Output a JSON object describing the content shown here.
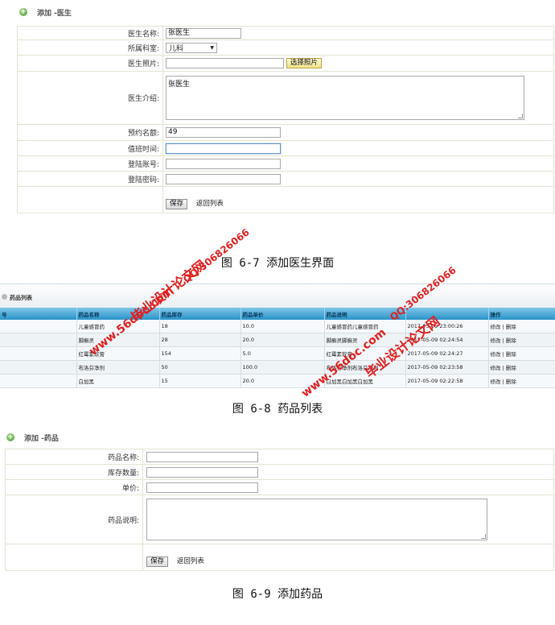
{
  "doctor_form": {
    "title": "添加 -医生",
    "labels": {
      "name": "医生名称:",
      "dept": "所属科室:",
      "photo": "医生照片:",
      "intro": "医生介绍:",
      "quota": "预约名额:",
      "duty": "值班时间:",
      "account": "登陆账号:",
      "password": "登陆密码:"
    },
    "values": {
      "name": "张医生",
      "dept": "儿科",
      "photo": "",
      "intro": "张医生",
      "quota": "49",
      "duty": "",
      "account": "",
      "password": ""
    },
    "choose_photo": "选择照片",
    "save": "保存",
    "back": "返回列表"
  },
  "caption_1": "图 6-7 添加医生界面",
  "medicine_list": {
    "title": "药品列表",
    "columns": [
      "号",
      "药品名称",
      "药品库存",
      "药品单价",
      "药品说明",
      "",
      "操作"
    ],
    "rows": [
      {
        "name": "儿童感冒药",
        "stock": "18",
        "price": "10.0",
        "desc": "儿童感冒药儿童感冒药",
        "time": "2017-05-09 23:00:26",
        "ops": "修改 | 删除"
      },
      {
        "name": "脚癣灵",
        "stock": "28",
        "price": "20.0",
        "desc": "脚癣灵脚癣灵",
        "time": "2017-05-09 02:24:54",
        "ops": "修改 | 删除"
      },
      {
        "name": "红霉素软膏",
        "stock": "154",
        "price": "5.0",
        "desc": "红霉素软膏",
        "time": "2017-05-09 02:24:27",
        "ops": "修改 | 删除"
      },
      {
        "name": "布洛芬净剂",
        "stock": "50",
        "price": "100.0",
        "desc": "布洛芬净剂布洛芬净剂",
        "time": "2017-05-09 02:23:58",
        "ops": "修改 | 删除"
      },
      {
        "name": "白加黑",
        "stock": "15",
        "price": "20.0",
        "desc": "白加黑白加黑白加黑",
        "time": "2017-05-09 02:22:58",
        "ops": "修改 | 删除"
      }
    ]
  },
  "caption_2": "图 6-8 药品列表",
  "medicine_form": {
    "title": "添加 -药品",
    "labels": {
      "name": "药品名称:",
      "stock": "库存数量:",
      "price": "单价:",
      "desc": "药品说明:"
    },
    "save": "保存",
    "back": "返回列表"
  },
  "caption_3": "图 6-9 添加药品",
  "watermark": {
    "site": "www.56doc.com",
    "text": "毕业设计论文网",
    "qq": "QQ:306826066"
  }
}
